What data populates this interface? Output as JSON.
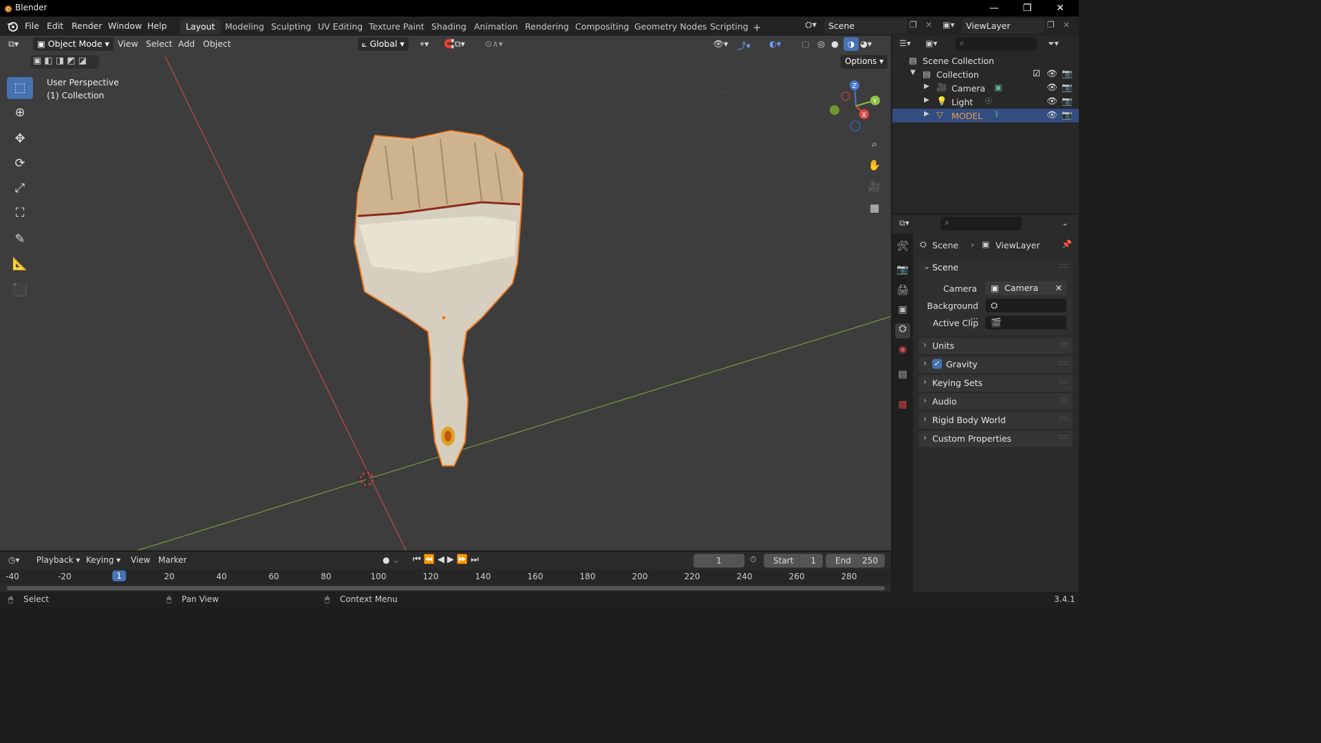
{
  "window": {
    "title": "Blender",
    "min": "—",
    "max": "❐",
    "close": "✕"
  },
  "menu": {
    "items": [
      "File",
      "Edit",
      "Render",
      "Window",
      "Help"
    ]
  },
  "workspaces": [
    "Layout",
    "Modeling",
    "Sculpting",
    "UV Editing",
    "Texture Paint",
    "Shading",
    "Animation",
    "Rendering",
    "Compositing",
    "Geometry Nodes",
    "Scripting"
  ],
  "add_workspace": "+",
  "scene_selector": {
    "value": "Scene"
  },
  "viewlayer_selector": {
    "value": "ViewLayer"
  },
  "viewport": {
    "mode": "Object Mode",
    "menus": [
      "View",
      "Select",
      "Add",
      "Object"
    ],
    "orientation": "Global",
    "options": "Options",
    "overlay_line1": "User Perspective",
    "overlay_line2": "(1) Collection",
    "gizmo": {
      "x": "X",
      "y": "Y",
      "z": "Z"
    }
  },
  "outliner": {
    "scene_collection": "Scene Collection",
    "collection": "Collection",
    "objects": [
      {
        "name": "Camera"
      },
      {
        "name": "Light"
      },
      {
        "name": "MODEL"
      }
    ],
    "colors": {
      "selected_text": "#e8a045",
      "selected_bg": "#334d80"
    }
  },
  "properties": {
    "breadcrumb": {
      "scene": "Scene",
      "viewlayer": "ViewLayer"
    },
    "scene_panel": "Scene",
    "camera_label": "Camera",
    "camera_value": "Camera",
    "background_label": "Background ...",
    "active_clip_label": "Active Clip",
    "panels": [
      "Units",
      "Gravity",
      "Keying Sets",
      "Audio",
      "Rigid Body World",
      "Custom Properties"
    ],
    "gravity_checked": true
  },
  "timeline": {
    "menus": [
      "Playback",
      "Keying",
      "View",
      "Marker"
    ],
    "current_frame": "1",
    "start_label": "Start",
    "start_value": "1",
    "end_label": "End",
    "end_value": "250",
    "ticks": [
      "-40",
      "-20",
      "1",
      "20",
      "40",
      "60",
      "80",
      "100",
      "120",
      "140",
      "160",
      "180",
      "200",
      "220",
      "240",
      "260",
      "280"
    ]
  },
  "statusbar": {
    "select": "Select",
    "pan": "Pan View",
    "context": "Context Menu",
    "version": "3.4.1"
  },
  "colors": {
    "accent": "#4772b3",
    "selection_outline": "#f07a20",
    "x_axis": "#c44a4a",
    "y_axis": "#7a9a3a"
  }
}
